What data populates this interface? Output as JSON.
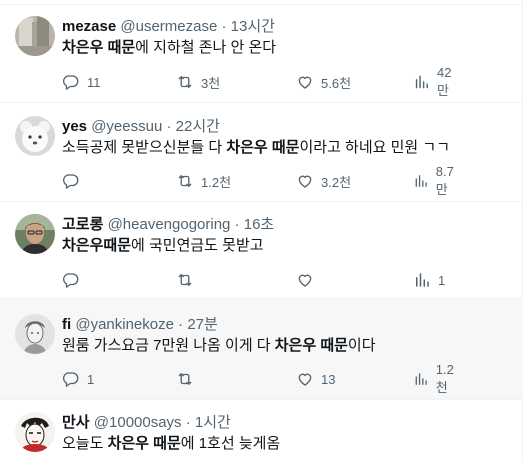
{
  "tweets": [
    {
      "name": "mezase",
      "handle": "@usermezase",
      "time": "13시간",
      "text_pre": "",
      "text_bold": "차은우 때문",
      "text_post": "에 지하철 존나 안 온다",
      "counts": {
        "reply": "11",
        "retweet": "3천",
        "like": "5.6천",
        "views": "42만"
      }
    },
    {
      "name": "yes",
      "handle": "@yeessuu",
      "time": "22시간",
      "text_pre": "소득공제 못받으신분들 다 ",
      "text_bold": "차은우 때문",
      "text_post": "이라고 하네요 민원 ㄱㄱ",
      "counts": {
        "reply": "",
        "retweet": "1.2천",
        "like": "3.2천",
        "views": "8.7만"
      }
    },
    {
      "name": "고로롱",
      "handle": "@heavengogoring",
      "time": "16초",
      "text_pre": "",
      "text_bold": "차은우때문",
      "text_post": "에 국민연금도 못받고",
      "counts": {
        "reply": "",
        "retweet": "",
        "like": "",
        "views": "1"
      }
    },
    {
      "name": "fi",
      "handle": "@yankinekoze",
      "time": "27분",
      "text_pre": "원룸 가스요금 7만원 나옴 이게 다 ",
      "text_bold": "차은우 때문",
      "text_post": "이다",
      "counts": {
        "reply": "1",
        "retweet": "",
        "like": "13",
        "views": "1.2천"
      }
    },
    {
      "name": "만사",
      "handle": "@10000says",
      "time": "1시간",
      "text_pre": "오늘도 ",
      "text_bold": "차은우 때문",
      "text_post": "에 1호선 늦게옴",
      "counts": {
        "reply": "",
        "retweet": "",
        "like": "",
        "views": ""
      }
    }
  ],
  "separator": "·",
  "colors": {
    "text": "#0f1419",
    "secondary": "#536471",
    "border": "#eff3f4",
    "hover_bg": "#f7f7f7"
  }
}
